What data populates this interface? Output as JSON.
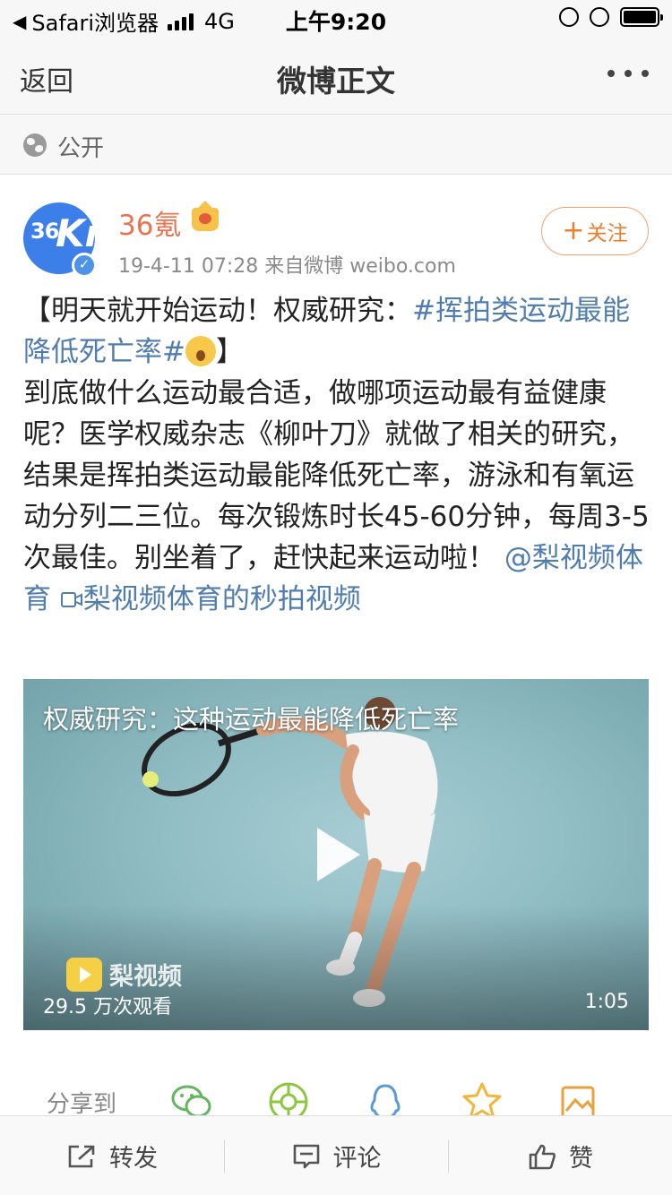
{
  "status_bar": {
    "back_app": "Safari浏览器",
    "network": "4G",
    "time": "上午9:20"
  },
  "nav": {
    "back": "返回",
    "title": "微博正文"
  },
  "visibility": {
    "label": "公开",
    "icon": "globe-icon"
  },
  "post": {
    "avatar_text": "36",
    "avatar_k": "Kr",
    "author": "36氪",
    "meta": "19-4-11 07:28  来自微博 weibo.com",
    "follow": "关注",
    "text": {
      "p1_open": "【明天就开始运动！权威研究：",
      "p1_tag": "#挥拍类运动最能降低死亡率#",
      "p1_close": "】",
      "p2": "到底做什么运动最合适，做哪项运动最有益健康呢？医学权威杂志《柳叶刀》就做了相关的研究，结果是挥拍类运动最能降低死亡率，游泳和有氧运动分列二三位。每次锻炼时长45-60分钟，每周3-5次最佳。别坐着了，赶快起来运动啦！",
      "mention": "@梨视频体育",
      "video_link": "梨视频体育的秒拍视频"
    },
    "video": {
      "title": "权威研究：这种运动最能降低死亡率",
      "logo": "梨视频",
      "views": "29.5 万次观看",
      "duration": "1:05"
    }
  },
  "share": {
    "label": "分享到",
    "targets": [
      "wechat-icon",
      "moments-icon",
      "qq-icon",
      "qzone-icon",
      "more-share-icon"
    ]
  },
  "toolbar": {
    "repost": "转发",
    "comment": "评论",
    "like": "赞"
  },
  "colors": {
    "accent_orange": "#eb7350",
    "link_blue": "#507daf",
    "share_wechat": "#63b65f",
    "share_moments": "#8dc63f",
    "share_qq": "#5b9bd5",
    "share_qzone": "#f2b73a",
    "share_more": "#e8a13c"
  }
}
